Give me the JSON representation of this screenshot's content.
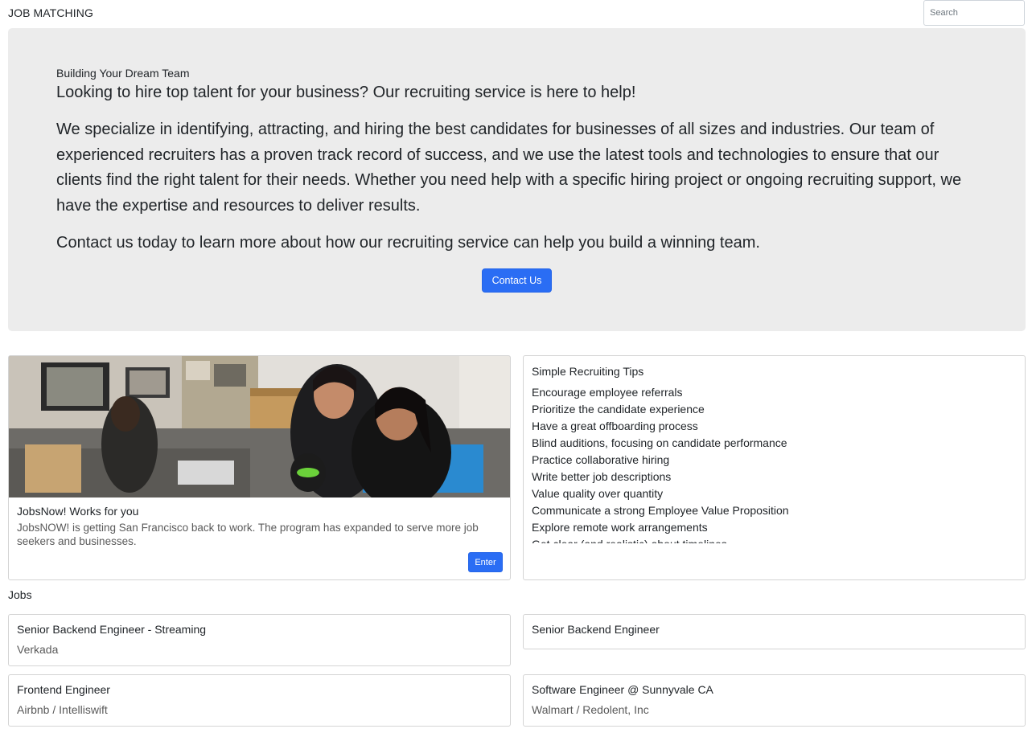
{
  "header": {
    "brand": "JOB MATCHING",
    "search_placeholder": "Search"
  },
  "hero": {
    "kicker": "Building Your Dream Team",
    "lead": "Looking to hire top talent for your business? Our recruiting service is here to help!",
    "paragraph": "We specialize in identifying, attracting, and hiring the best candidates for businesses of all sizes and industries. Our team of experienced recruiters has a proven track record of success, and we use the latest tools and technologies to ensure that our clients find the right talent for their needs. Whether you need help with a specific hiring project or ongoing recruiting support, we have the expertise and resources to deliver results.",
    "contact_text": "Contact us today to learn more about how our recruiting service can help you build a winning team.",
    "contact_button": "Contact Us"
  },
  "feature_card": {
    "title": "JobsNow! Works for you",
    "text": "JobsNOW! is getting San Francisco back to work. The program has expanded to serve more job seekers and businesses.",
    "enter_button": "Enter"
  },
  "tips": {
    "title": "Simple Recruiting Tips",
    "items": [
      "Encourage employee referrals",
      "Prioritize the candidate experience",
      "Have a great offboarding process",
      "Blind auditions, focusing on candidate performance",
      "Practice collaborative hiring",
      "Write better job descriptions",
      "Value quality over quantity",
      "Communicate a strong Employee Value Proposition",
      "Explore remote work arrangements",
      "Get clear (and realistic) about timelines"
    ]
  },
  "jobs": {
    "heading": "Jobs",
    "items": [
      {
        "title": "Senior Backend Engineer - Streaming",
        "company": "Verkada"
      },
      {
        "title": "Senior Backend Engineer",
        "company": ""
      },
      {
        "title": "Frontend Engineer",
        "company": "Airbnb / Intelliswift"
      },
      {
        "title": "Software Engineer @ Sunnyvale CA",
        "company": "Walmart / Redolent, Inc"
      }
    ]
  },
  "colors": {
    "primary": "#2a6df4",
    "hero_bg": "#ececec",
    "card_border": "#d4d4d4",
    "muted_text": "#5a5a5a"
  }
}
